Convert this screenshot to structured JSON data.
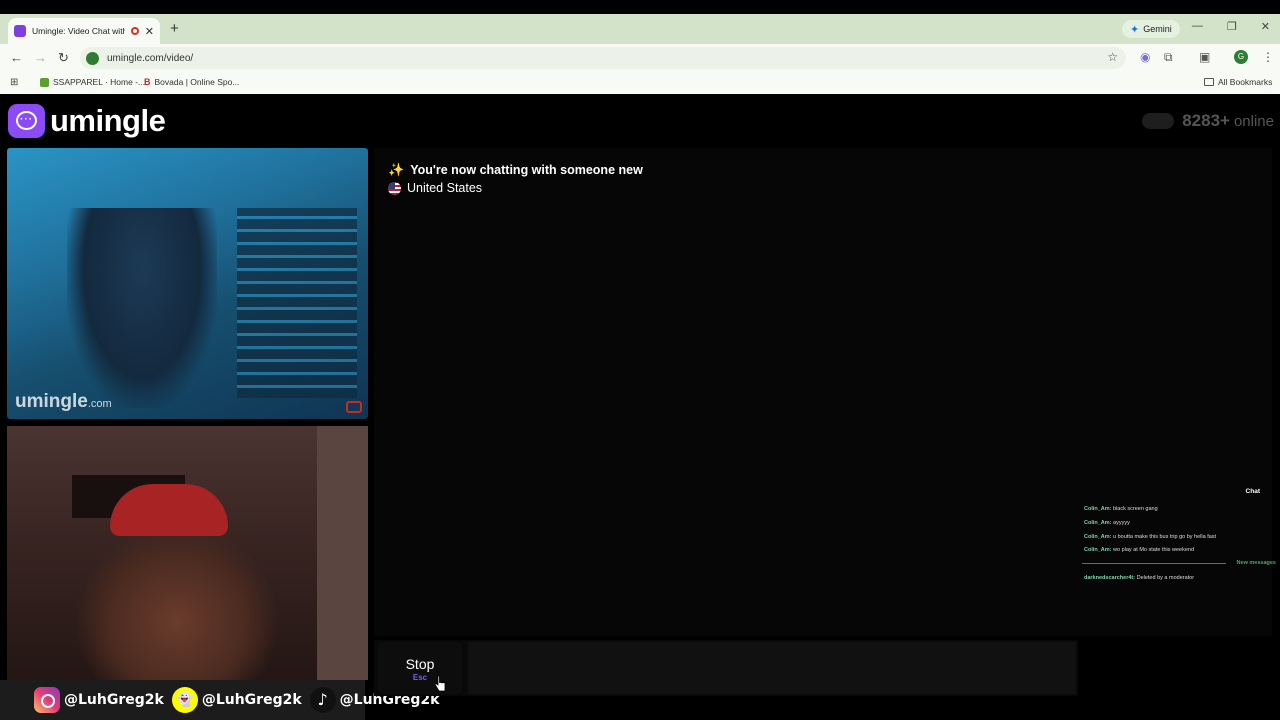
{
  "browser": {
    "tab_title": "Umingle: Video Chat with S",
    "new_tab": "+",
    "gemini_label": "Gemini",
    "url": "umingle.com/video/",
    "bookmarks": [
      {
        "label": "SSAPPAREL · Home -..."
      },
      {
        "label": "Bovada | Online Spo..."
      }
    ],
    "all_bookmarks": "All Bookmarks",
    "profile_initial": "G"
  },
  "site": {
    "logo_text": "umingle",
    "online_count": "8283+",
    "online_label": "online"
  },
  "video": {
    "watermark": "umingle",
    "watermark_tld": ".com"
  },
  "socials": [
    {
      "icon": "instagram-icon",
      "handle": "@LuhGreg2k"
    },
    {
      "icon": "snapchat-icon",
      "handle": "@LuhGreg2k"
    },
    {
      "icon": "tiktok-icon",
      "handle": "@LuhGreg2k"
    }
  ],
  "chat": {
    "status_new": "You're now chatting with someone new",
    "country": "United States"
  },
  "stream_chat": {
    "title": "Chat",
    "messages": [
      {
        "user": "Colin_Am:",
        "text": "black screen gang"
      },
      {
        "user": "Colin_Am:",
        "text": "ayyyyy"
      },
      {
        "user": "Colin_Am:",
        "text": "u boutta make this bus trip go by hella fast"
      },
      {
        "user": "Colin_Am:",
        "text": "wo play at Mo state this weekend"
      }
    ],
    "new_messages": "New messages",
    "deleted": {
      "user": "darknedscarcher4t:",
      "text": "Deleted by a moderator"
    }
  },
  "controls": {
    "stop_label": "Stop",
    "stop_key": "Esc",
    "input_value": "",
    "input_placeholder": ""
  },
  "colors": {
    "brand": "#8b4cf7",
    "accent_key": "#7b5cf0",
    "browser_bar": "#d3e3c9"
  }
}
